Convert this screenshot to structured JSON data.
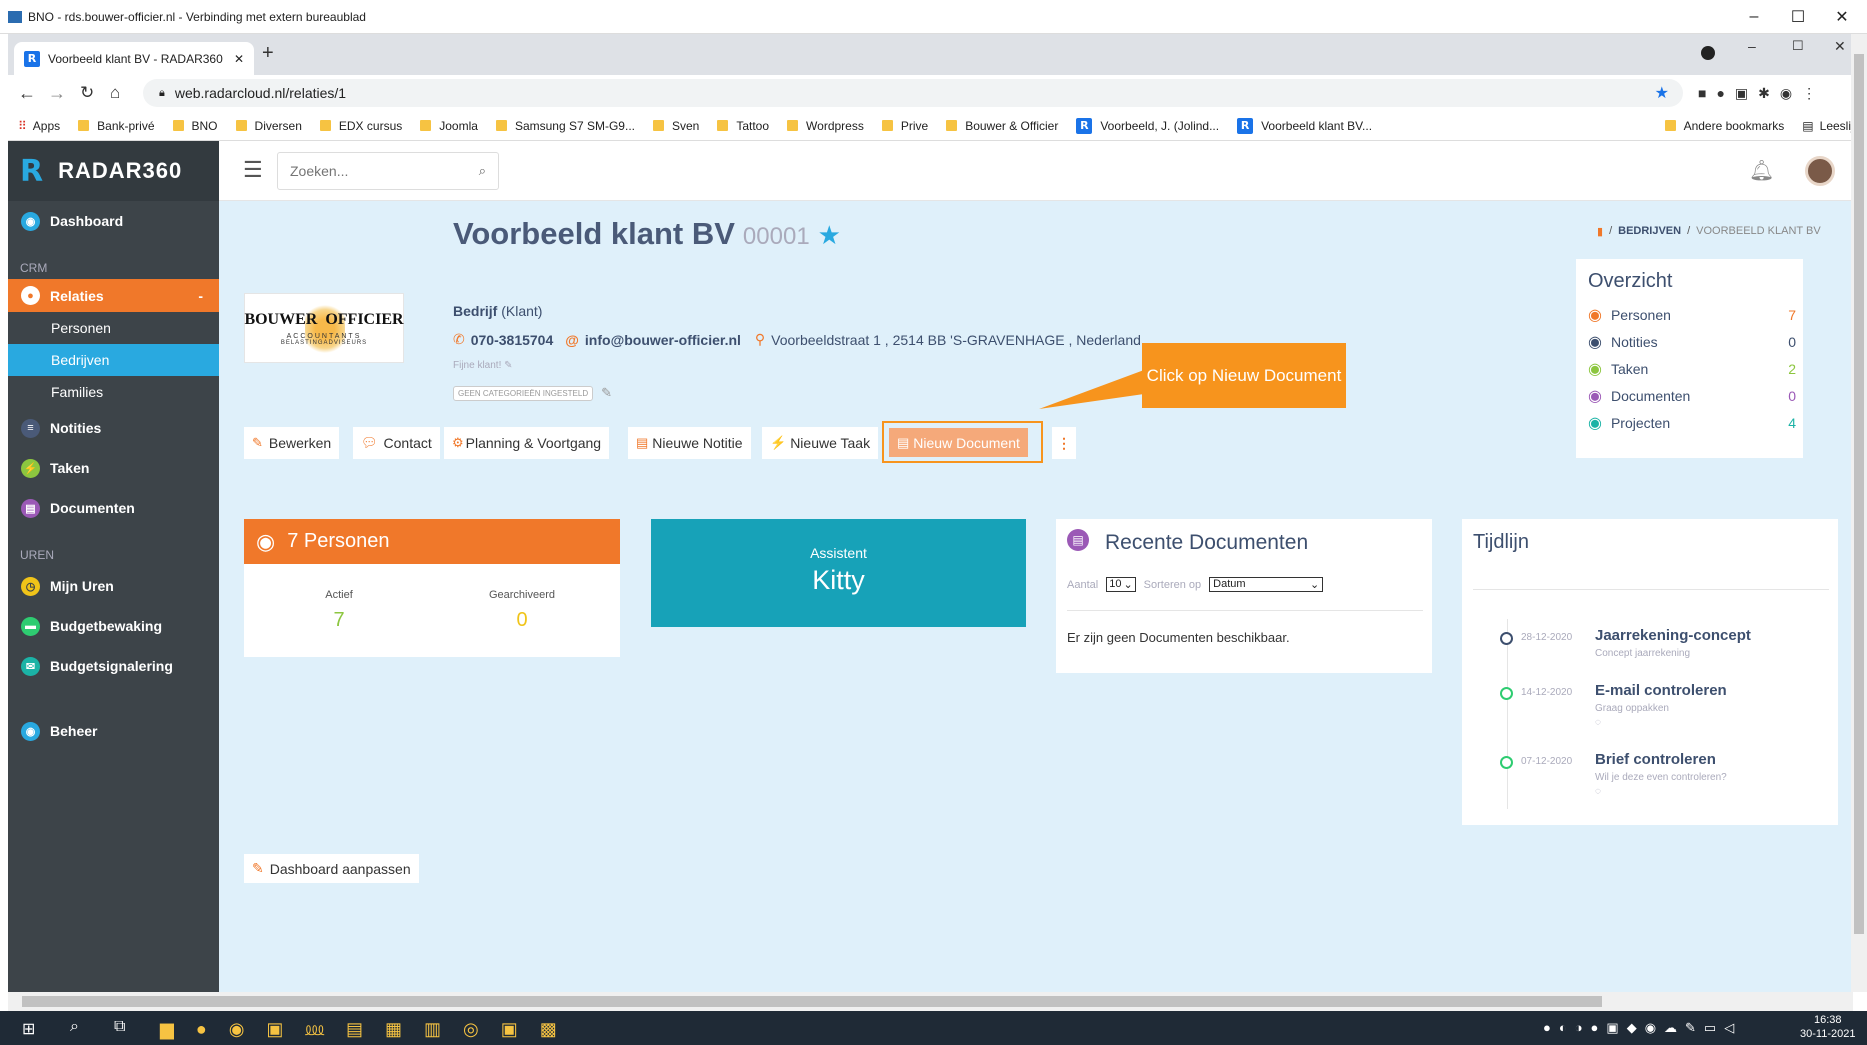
{
  "rdp": {
    "title": "BNO - rds.bouwer-officier.nl - Verbinding met extern bureaublad"
  },
  "browser": {
    "tab_title": "Voorbeeld klant BV - RADAR360",
    "url": "web.radarcloud.nl/relaties/1",
    "bookmarks": [
      "Apps",
      "Bank-privé",
      "BNO",
      "Diversen",
      "EDX cursus",
      "Joomla",
      "Samsung S7 SM-G9...",
      "Sven",
      "Tattoo",
      "Wordpress",
      "Prive",
      "Bouwer & Officier",
      "Voorbeeld, J. (Jolind...",
      "Voorbeeld klant BV..."
    ],
    "other_bookmarks": "Andere bookmarks",
    "reading_list": "Leeslijst"
  },
  "sidebar": {
    "brand": "RADAR360",
    "dashboard": "Dashboard",
    "crm": "CRM",
    "relaties": "Relaties",
    "relaties_toggle": "-",
    "personen": "Personen",
    "bedrijven": "Bedrijven",
    "families": "Families",
    "notities": "Notities",
    "taken": "Taken",
    "documenten": "Documenten",
    "uren": "UREN",
    "mijn_uren": "Mijn Uren",
    "budgetbewaking": "Budgetbewaking",
    "budgetsignalering": "Budgetsignalering",
    "beheer": "Beheer"
  },
  "topbar": {
    "search_placeholder": "Zoeken..."
  },
  "breadcrumb": {
    "sep1": "/",
    "level1": "BEDRIJVEN",
    "sep2": "/",
    "level2": "VOORBEELD KLANT BV"
  },
  "company": {
    "logo_line1": "BOUWER  OFFICIER",
    "logo_line2": "ACCOUNTANTS",
    "logo_line3": "BELASTINGADVISEURS",
    "name": "Voorbeeld klant BV",
    "number": "00001",
    "type": "Bedrijf",
    "type_sub": "(Klant)",
    "phone": "070-3815704",
    "email": "info@bouwer-officier.nl",
    "address": "Voorbeeldstraat 1 , 2514 BB 'S-GRAVENHAGE , Nederland",
    "note": "Fijne klant!",
    "categories": "GEEN CATEGORIEËN INGESTELD"
  },
  "actions": {
    "bewerken": "Bewerken",
    "contact": "Contact",
    "planning": "Planning & Voortgang",
    "notitie": "Nieuwe Notitie",
    "taak": "Nieuwe Taak",
    "document": "Nieuw Document",
    "more": "⋮"
  },
  "callout": {
    "text": "Click op Nieuw Document"
  },
  "overzicht": {
    "title": "Overzicht",
    "items": [
      {
        "label": "Personen",
        "value": "7",
        "color": "#f0782a"
      },
      {
        "label": "Notities",
        "value": "0",
        "color": "#3d4f6e"
      },
      {
        "label": "Taken",
        "value": "2",
        "color": "#8cc63f"
      },
      {
        "label": "Documenten",
        "value": "0",
        "color": "#9b59b6"
      },
      {
        "label": "Projecten",
        "value": "4",
        "color": "#1bb3a6"
      }
    ]
  },
  "personen_card": {
    "title": "7 Personen",
    "actief_label": "Actief",
    "actief_value": "7",
    "gearchiveerd_label": "Gearchiveerd",
    "gearchiveerd_value": "0"
  },
  "assistent": {
    "label": "Assistent",
    "name": "Kitty"
  },
  "recent_docs": {
    "title": "Recente Documenten",
    "aantal_label": "Aantal",
    "aantal_value": "10",
    "sort_label": "Sorteren op",
    "sort_value": "Datum",
    "empty": "Er zijn geen Documenten beschikbaar."
  },
  "tijdlijn": {
    "title": "Tijdlijn",
    "items": [
      {
        "date": "28-12-2020",
        "title": "Jaarrekening-concept",
        "sub": "Concept jaarrekening",
        "comment": false,
        "color": "#3d4f6e"
      },
      {
        "date": "14-12-2020",
        "title": "E-mail controleren",
        "sub": "Graag oppakken",
        "comment": true,
        "color": "#2ecc71"
      },
      {
        "date": "07-12-2020",
        "title": "Brief controleren",
        "sub": "Wil je deze even controleren?",
        "comment": true,
        "color": "#2ecc71"
      }
    ]
  },
  "dashboard_btn": "Dashboard aanpassen",
  "taskbar": {
    "time": "16:38",
    "date": "30-11-2021"
  }
}
